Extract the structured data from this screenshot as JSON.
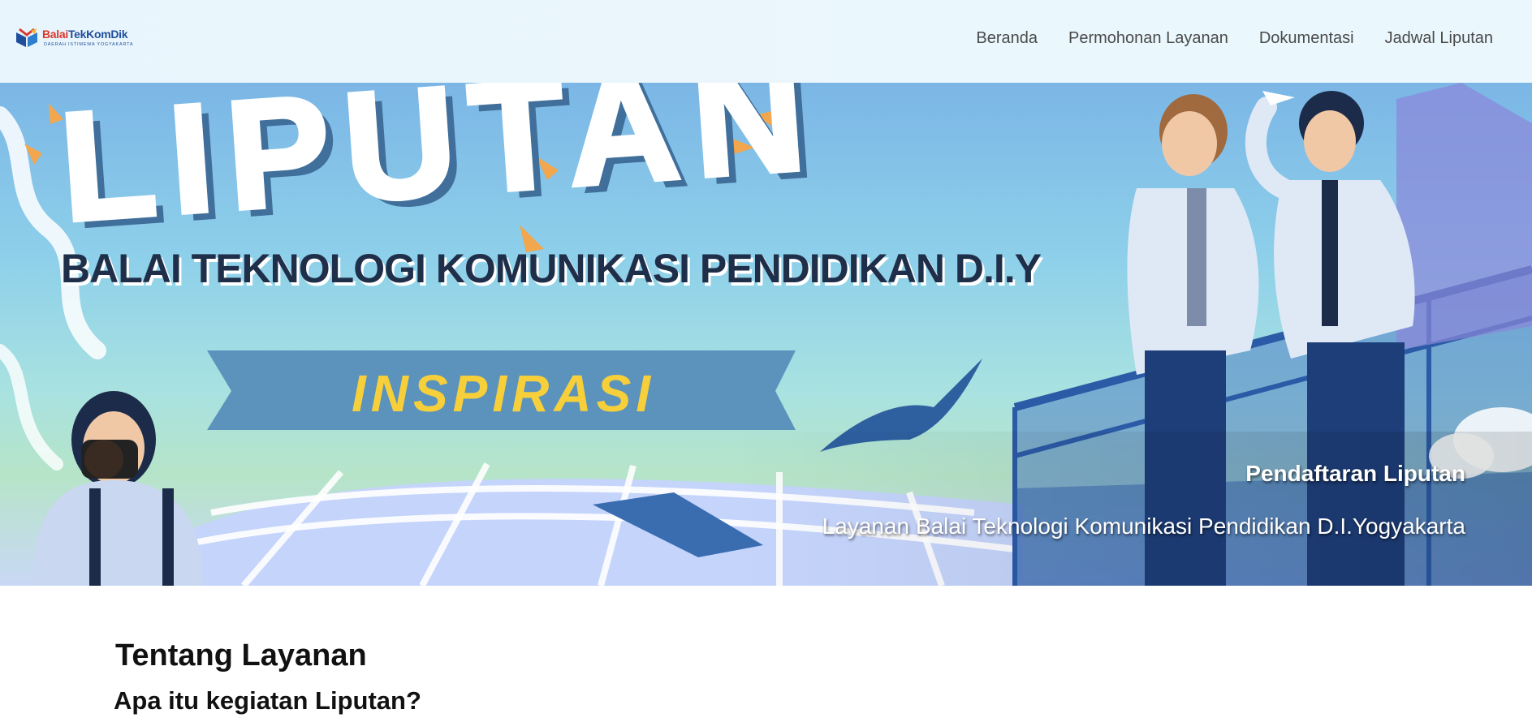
{
  "brand": {
    "name_part1": "Balai",
    "name_part2": "TekKomDik",
    "tagline": "DAERAH ISTIMEWA YOGYAKARTA"
  },
  "nav": {
    "items": [
      {
        "label": "Beranda"
      },
      {
        "label": "Permohonan Layanan"
      },
      {
        "label": "Dokumentasi"
      },
      {
        "label": "Jadwal Liputan"
      }
    ]
  },
  "hero": {
    "headline": "LIPUTAN",
    "org": "BALAI TEKNOLOGI KOMUNIKASI PENDIDIKAN D.I.Y",
    "ribbon": "INSPIRASI",
    "caption_title": "Pendaftaran Liputan",
    "caption_subtitle": "Layanan Balai Teknologi Komunikasi Pendidikan D.I.Yogyakarta"
  },
  "about": {
    "title": "Tentang Layanan",
    "subtitle": "Apa itu kegiatan Liputan?"
  },
  "colors": {
    "nav_text": "#4a4a4a",
    "ribbon": "#5b93bd",
    "ribbon_text": "#f6cf3a",
    "headline_fill": "#ffffff",
    "headline_shadow": "#3f6f9a"
  }
}
